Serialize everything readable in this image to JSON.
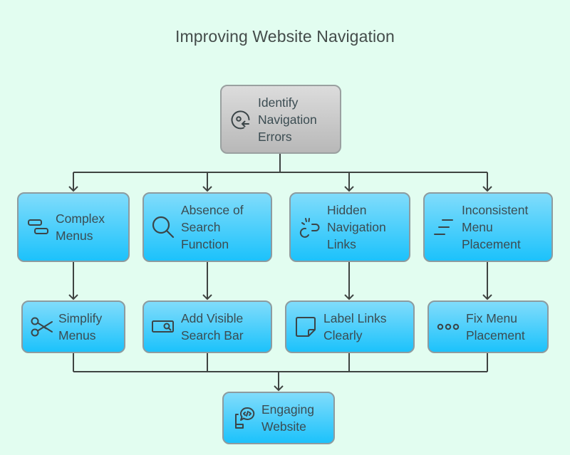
{
  "title": "Improving Website Navigation",
  "colors": {
    "background": "#e2fdf0",
    "node_fill_top": "#80dcfb",
    "node_fill_bottom": "#1cc2fb",
    "root_fill_top": "#dcdcdc",
    "root_fill_bottom": "#b8b8b8",
    "connector": "#3f4442",
    "text": "#3b4c52"
  },
  "root": {
    "label": "Identify\nNavigation\nErrors",
    "icon": "target-return-icon"
  },
  "problems": [
    {
      "label": "Complex\nMenus",
      "icon": "stacked-bars-icon"
    },
    {
      "label": "Absence of\nSearch\nFunction",
      "icon": "magnifier-icon"
    },
    {
      "label": "Hidden\nNavigation\nLinks",
      "icon": "broken-link-icon"
    },
    {
      "label": "Inconsistent\nMenu\nPlacement",
      "icon": "staggered-lines-icon"
    }
  ],
  "solutions": [
    {
      "label": "Simplify\nMenus",
      "icon": "scissors-icon"
    },
    {
      "label": "Add Visible\nSearch Bar",
      "icon": "search-bar-icon"
    },
    {
      "label": "Label Links\nClearly",
      "icon": "sticky-note-icon"
    },
    {
      "label": "Fix Menu\nPlacement",
      "icon": "ellipsis-icon"
    }
  ],
  "outcome": {
    "label": "Engaging\nWebsite",
    "icon": "phone-code-bubble-icon"
  }
}
